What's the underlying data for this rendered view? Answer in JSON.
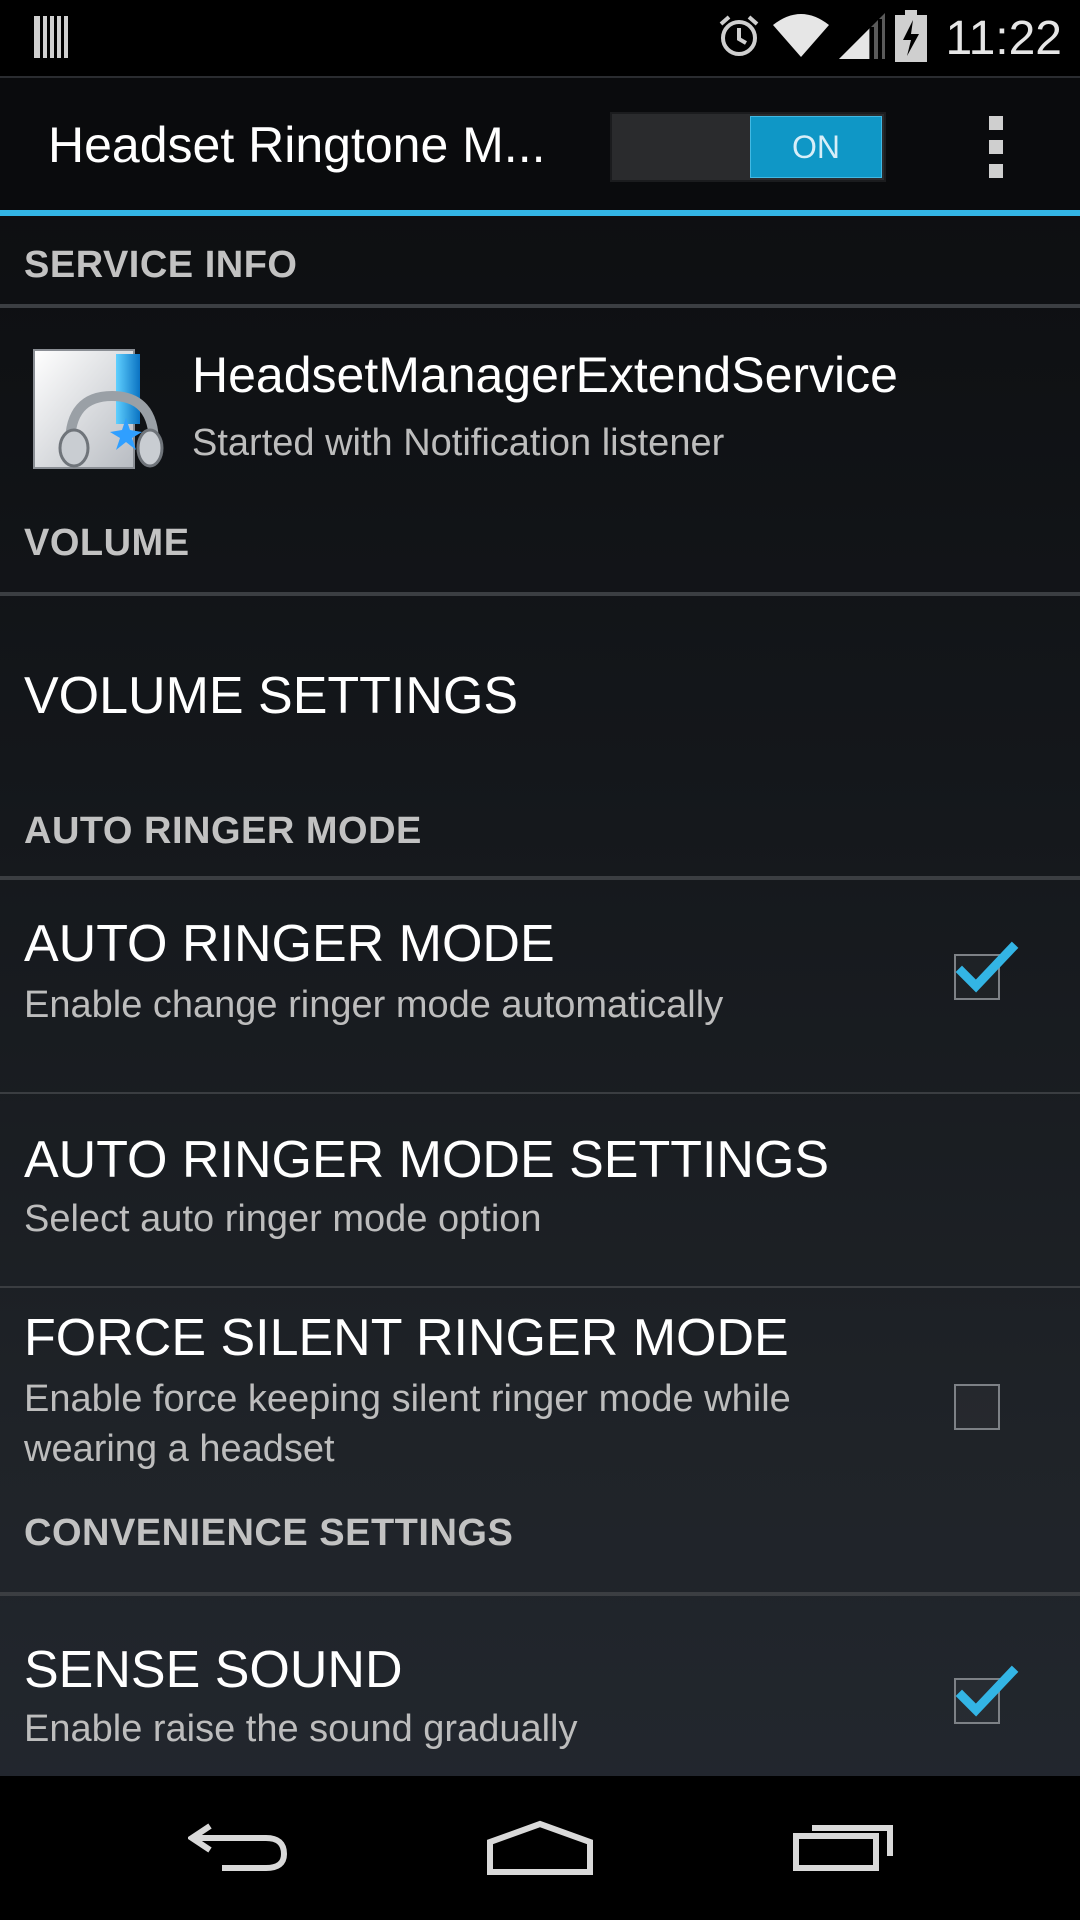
{
  "status_bar": {
    "time": "11:22",
    "icons": [
      "notification-bars-icon",
      "alarm-icon",
      "wifi-icon",
      "signal-icon",
      "battery-charging-icon"
    ]
  },
  "action_bar": {
    "title": "Headset Ringtone M...",
    "toggle_label": "ON",
    "toggle_state": "on",
    "overflow_icon": "overflow-menu-icon"
  },
  "colors": {
    "accent": "#33b5e5",
    "toggle_on": "#0f97c6",
    "checkbox_check": "#33b5e5"
  },
  "sections": {
    "service_info": {
      "header": "SERVICE INFO",
      "service_name": "HeadsetManagerExtendService",
      "service_status": "Started with Notification listener"
    },
    "volume": {
      "header": "VOLUME",
      "settings_title": "VOLUME SETTINGS"
    },
    "auto_ringer": {
      "header": "AUTO RINGER MODE",
      "items": [
        {
          "title": "AUTO RINGER MODE",
          "summary": "Enable change ringer mode automatically",
          "checked": true
        },
        {
          "title": "AUTO RINGER MODE SETTINGS",
          "summary": "Select auto ringer mode option"
        },
        {
          "title": "FORCE SILENT RINGER MODE",
          "summary": "Enable force keeping silent ringer mode while wearing a headset",
          "checked": false
        }
      ]
    },
    "convenience": {
      "header": "CONVENIENCE SETTINGS",
      "items": [
        {
          "title": "SENSE SOUND",
          "summary": "Enable raise the sound gradually",
          "checked": true
        }
      ]
    }
  },
  "nav_bar": {
    "buttons": [
      "back-icon",
      "home-icon",
      "recent-apps-icon"
    ]
  }
}
